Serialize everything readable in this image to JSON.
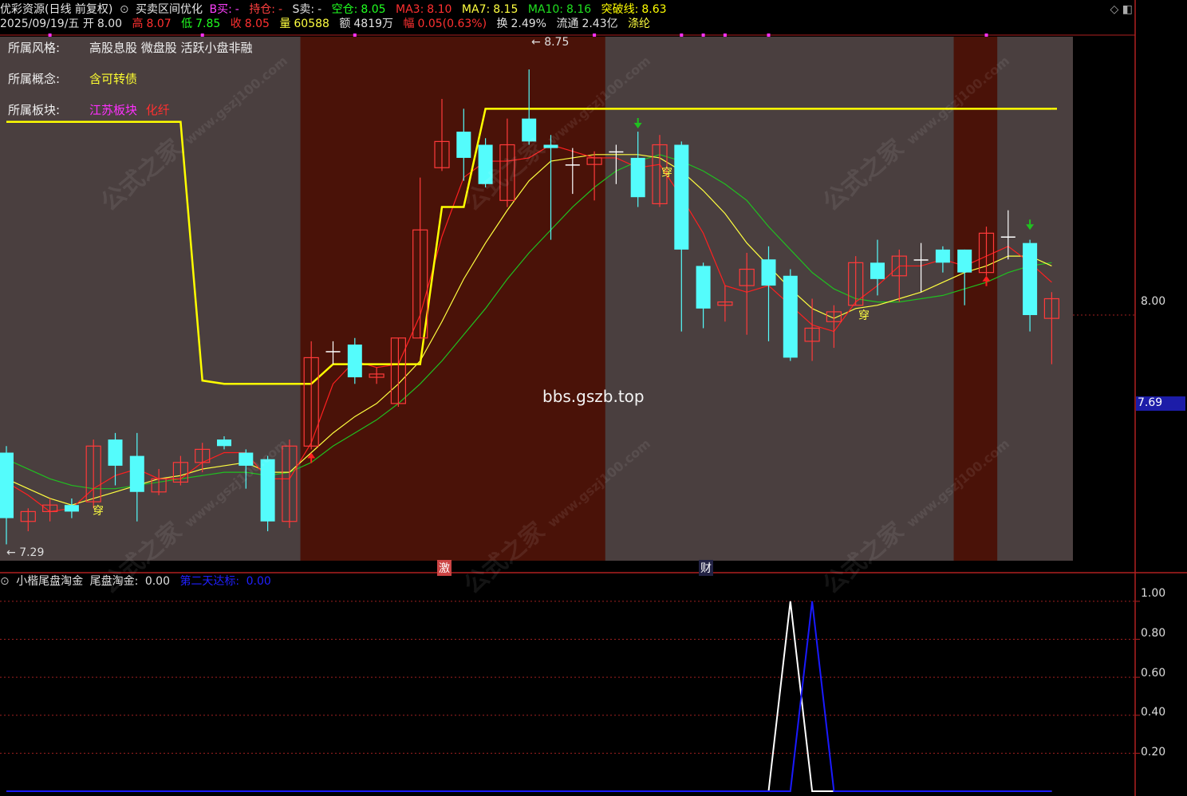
{
  "header": {
    "title": "优彩资源(日线 前复权)",
    "indicator_name": "买卖区间优化",
    "b_buy_label": "B买:",
    "b_buy_value": "-",
    "hold_label": "持仓:",
    "hold_value": "-",
    "s_sell_label": "S卖:",
    "s_sell_value": "-",
    "empty_label": "空仓:",
    "empty_value": "8.05",
    "ma3_label": "MA3:",
    "ma3_value": "8.10",
    "ma7_label": "MA7:",
    "ma7_value": "8.15",
    "ma10_label": "MA10:",
    "ma10_value": "8.16",
    "breakout_label": "突破线:",
    "breakout_value": "8.63",
    "date": "2025/09/19/五",
    "open_label": "开",
    "open_value": "8.00",
    "high_label": "高",
    "high_value": "8.07",
    "low_label": "低",
    "low_value": "7.85",
    "close_label": "收",
    "close_value": "8.05",
    "volume_label": "量",
    "volume_value": "60588",
    "amount_label": "额",
    "amount_value": "4819万",
    "change_label": "幅",
    "change_value": "0.05(0.63%)",
    "turnover_label": "换",
    "turnover_value": "2.49%",
    "float_label": "流通",
    "float_value": "2.43亿",
    "sector_tag": "涤纶"
  },
  "info_panel": {
    "style_label": "所属风格:",
    "style_value": "高股息股 微盘股 活跃小盘非融",
    "concept_label": "所属概念:",
    "concept_value": "含可转债",
    "block_label": "所属板块:",
    "block_value1": "江苏板块",
    "block_value2": "化纤"
  },
  "watermarks": {
    "brand": "公式之家",
    "site": "www.gszj100.com",
    "center": "bbs.gszb.top"
  },
  "markers": {
    "max_label": "8.75",
    "min_label": "7.29",
    "signal1": "激",
    "signal2": "财",
    "cross_label": "穿"
  },
  "price_axis": {
    "current_price": "7.69",
    "level_800": "8.00"
  },
  "sub_panel": {
    "title": "小楷尾盘淘金",
    "main_label": "尾盘淘金:",
    "main_value": "0.00",
    "second_label": "第二天达标:",
    "second_value": "0.00",
    "ticks": [
      "1.00",
      "0.80",
      "0.60",
      "0.40",
      "0.20"
    ]
  },
  "colors": {
    "up": "#ff3a3a",
    "down": "#54fcfc",
    "ma3": "#ff2020",
    "ma7": "#ffff40",
    "ma10": "#20c020",
    "breakout": "#ffff00",
    "bg_normal": "#4a3f3f",
    "bg_hold": "#4a1208",
    "sub_white": "#ffffff",
    "sub_blue": "#1a1aff"
  },
  "chart_data": {
    "type": "candlestick",
    "title": "优彩资源(日线 前复权)",
    "ylim": [
      7.25,
      8.85
    ],
    "candles": [
      {
        "o": 7.58,
        "c": 7.38,
        "h": 7.6,
        "l": 7.3
      },
      {
        "o": 7.37,
        "c": 7.4,
        "h": 7.41,
        "l": 7.34
      },
      {
        "o": 7.4,
        "c": 7.42,
        "h": 7.44,
        "l": 7.37
      },
      {
        "o": 7.42,
        "c": 7.4,
        "h": 7.44,
        "l": 7.38
      },
      {
        "o": 7.43,
        "c": 7.6,
        "h": 7.62,
        "l": 7.41
      },
      {
        "o": 7.62,
        "c": 7.54,
        "h": 7.64,
        "l": 7.48
      },
      {
        "o": 7.57,
        "c": 7.46,
        "h": 7.64,
        "l": 7.37
      },
      {
        "o": 7.46,
        "c": 7.5,
        "h": 7.53,
        "l": 7.45
      },
      {
        "o": 7.49,
        "c": 7.55,
        "h": 7.57,
        "l": 7.48
      },
      {
        "o": 7.55,
        "c": 7.59,
        "h": 7.61,
        "l": 7.52
      },
      {
        "o": 7.62,
        "c": 7.6,
        "h": 7.63,
        "l": 7.59
      },
      {
        "o": 7.58,
        "c": 7.54,
        "h": 7.59,
        "l": 7.47
      },
      {
        "o": 7.56,
        "c": 7.37,
        "h": 7.57,
        "l": 7.34
      },
      {
        "o": 7.37,
        "c": 7.6,
        "h": 7.62,
        "l": 7.35
      },
      {
        "o": 7.6,
        "c": 7.87,
        "h": 7.92,
        "l": 7.59
      },
      {
        "o": 7.89,
        "c": 7.89,
        "h": 7.92,
        "l": 7.85
      },
      {
        "o": 7.91,
        "c": 7.81,
        "h": 7.93,
        "l": 7.79
      },
      {
        "o": 7.81,
        "c": 7.82,
        "h": 7.84,
        "l": 7.79
      },
      {
        "o": 7.73,
        "c": 7.93,
        "h": 7.93,
        "l": 7.72
      },
      {
        "o": 7.93,
        "c": 8.26,
        "h": 8.42,
        "l": 7.93
      },
      {
        "o": 8.45,
        "c": 8.53,
        "h": 8.66,
        "l": 8.44
      },
      {
        "o": 8.56,
        "c": 8.48,
        "h": 8.63,
        "l": 8.41
      },
      {
        "o": 8.52,
        "c": 8.4,
        "h": 8.54,
        "l": 8.39
      },
      {
        "o": 8.35,
        "c": 8.52,
        "h": 8.6,
        "l": 8.33
      },
      {
        "o": 8.6,
        "c": 8.53,
        "h": 8.75,
        "l": 8.52
      },
      {
        "o": 8.52,
        "c": 8.51,
        "h": 8.55,
        "l": 8.23
      },
      {
        "o": 8.46,
        "c": 8.46,
        "h": 8.51,
        "l": 8.37
      },
      {
        "o": 8.46,
        "c": 8.48,
        "h": 8.5,
        "l": 8.35
      },
      {
        "o": 8.5,
        "c": 8.5,
        "h": 8.52,
        "l": 8.4
      },
      {
        "o": 8.48,
        "c": 8.36,
        "h": 8.56,
        "l": 8.33
      },
      {
        "o": 8.34,
        "c": 8.52,
        "h": 8.55,
        "l": 8.33
      },
      {
        "o": 8.52,
        "c": 8.2,
        "h": 8.53,
        "l": 7.95
      },
      {
        "o": 8.15,
        "c": 8.02,
        "h": 8.16,
        "l": 7.96
      },
      {
        "o": 8.03,
        "c": 8.04,
        "h": 8.09,
        "l": 7.98
      },
      {
        "o": 8.09,
        "c": 8.14,
        "h": 8.19,
        "l": 7.94
      },
      {
        "o": 8.17,
        "c": 8.09,
        "h": 8.21,
        "l": 7.92
      },
      {
        "o": 8.12,
        "c": 7.87,
        "h": 8.14,
        "l": 7.86
      },
      {
        "o": 7.92,
        "c": 7.96,
        "h": 8.05,
        "l": 7.86
      },
      {
        "o": 7.98,
        "c": 8.01,
        "h": 8.03,
        "l": 7.9
      },
      {
        "o": 8.03,
        "c": 8.16,
        "h": 8.18,
        "l": 8.03
      },
      {
        "o": 8.16,
        "c": 8.11,
        "h": 8.23,
        "l": 8.06
      },
      {
        "o": 8.12,
        "c": 8.18,
        "h": 8.2,
        "l": 8.04
      },
      {
        "o": 8.17,
        "c": 8.17,
        "h": 8.22,
        "l": 8.07
      },
      {
        "o": 8.2,
        "c": 8.16,
        "h": 8.21,
        "l": 8.13
      },
      {
        "o": 8.2,
        "c": 8.13,
        "h": 8.2,
        "l": 8.03
      },
      {
        "o": 8.13,
        "c": 8.25,
        "h": 8.27,
        "l": 8.12
      },
      {
        "o": 8.24,
        "c": 8.24,
        "h": 8.32,
        "l": 8.17
      },
      {
        "o": 8.22,
        "c": 8.0,
        "h": 8.23,
        "l": 7.95
      },
      {
        "o": 7.99,
        "c": 8.05,
        "h": 8.07,
        "l": 7.85
      }
    ],
    "ma3": [
      7.49,
      7.45,
      7.4,
      7.41,
      7.47,
      7.51,
      7.53,
      7.5,
      7.5,
      7.55,
      7.58,
      7.58,
      7.5,
      7.5,
      7.61,
      7.79,
      7.86,
      7.84,
      7.85,
      8.0,
      8.24,
      8.42,
      8.47,
      8.47,
      8.48,
      8.52,
      8.5,
      8.48,
      8.48,
      8.45,
      8.46,
      8.36,
      8.25,
      8.09,
      8.07,
      8.09,
      8.03,
      7.97,
      7.95,
      8.04,
      8.09,
      8.15,
      8.15,
      8.17,
      8.15,
      8.18,
      8.21,
      8.16,
      8.1
    ],
    "ma7": [
      7.5,
      7.47,
      7.44,
      7.42,
      7.44,
      7.46,
      7.48,
      7.5,
      7.51,
      7.53,
      7.54,
      7.55,
      7.52,
      7.52,
      7.58,
      7.64,
      7.69,
      7.73,
      7.79,
      7.86,
      7.98,
      8.11,
      8.22,
      8.32,
      8.41,
      8.47,
      8.48,
      8.49,
      8.49,
      8.49,
      8.48,
      8.44,
      8.38,
      8.31,
      8.22,
      8.15,
      8.08,
      8.02,
      7.99,
      8.02,
      8.03,
      8.05,
      8.07,
      8.1,
      8.13,
      8.15,
      8.18,
      8.18,
      8.15
    ],
    "ma10": [
      7.56,
      7.53,
      7.5,
      7.48,
      7.47,
      7.47,
      7.48,
      7.49,
      7.5,
      7.51,
      7.52,
      7.52,
      7.51,
      7.52,
      7.55,
      7.6,
      7.64,
      7.68,
      7.73,
      7.79,
      7.86,
      7.94,
      8.02,
      8.11,
      8.19,
      8.26,
      8.33,
      8.39,
      8.44,
      8.47,
      8.49,
      8.47,
      8.44,
      8.4,
      8.35,
      8.27,
      8.2,
      8.13,
      8.08,
      8.05,
      8.04,
      8.04,
      8.05,
      8.06,
      8.08,
      8.1,
      8.13,
      8.15,
      8.16
    ],
    "breakout_line": [
      8.59,
      8.59,
      8.59,
      8.59,
      8.59,
      8.59,
      8.59,
      8.59,
      8.59,
      7.8,
      7.79,
      7.79,
      7.79,
      7.79,
      7.79,
      7.85,
      7.85,
      7.85,
      7.85,
      7.85,
      8.33,
      8.33,
      8.63,
      8.63,
      8.63,
      8.63,
      8.63,
      8.63,
      8.63,
      8.63,
      8.63,
      8.63,
      8.63,
      8.63,
      8.63,
      8.63,
      8.63,
      8.63,
      8.63,
      8.63,
      8.63,
      8.63,
      8.63,
      8.63,
      8.63,
      8.63,
      8.63,
      8.63,
      8.63
    ],
    "hold_zones": [
      [
        14,
        27
      ],
      [
        44,
        45
      ]
    ],
    "sub_white": [
      0,
      0,
      0,
      0,
      0,
      0,
      0,
      0,
      0,
      0,
      0,
      0,
      0,
      0,
      0,
      0,
      0,
      0,
      0,
      0,
      0,
      0,
      0,
      0,
      0,
      0,
      0,
      0,
      0,
      0,
      0,
      0,
      0,
      0,
      0,
      0,
      1,
      0,
      0,
      0,
      0,
      0,
      0,
      0,
      0,
      0,
      0,
      0,
      0
    ],
    "sub_blue": [
      0,
      0,
      0,
      0,
      0,
      0,
      0,
      0,
      0,
      0,
      0,
      0,
      0,
      0,
      0,
      0,
      0,
      0,
      0,
      0,
      0,
      0,
      0,
      0,
      0,
      0,
      0,
      0,
      0,
      0,
      0,
      0,
      0,
      0,
      0,
      0,
      0,
      1,
      0,
      0,
      0,
      0,
      0,
      0,
      0,
      0,
      0,
      0,
      0
    ],
    "sub_ylim": [
      0,
      1.05
    ]
  }
}
